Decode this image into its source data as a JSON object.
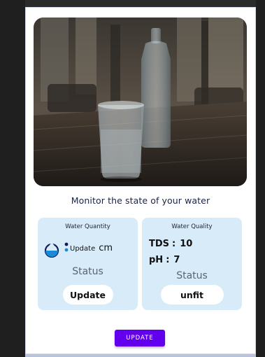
{
  "headline": "Monitor the state of your water",
  "quantity_card": {
    "title": "Water Quantity",
    "value_text": "Update",
    "unit": "cm",
    "status_label": "Status",
    "status_value": "Update"
  },
  "quality_card": {
    "title": "Water Quality",
    "tds_label": "TDS",
    "tds_value": "10",
    "ph_label": "pH",
    "ph_value": "7",
    "status_label": "Status",
    "status_value": "unfit"
  },
  "update_button": "UPDATE",
  "icons": [
    "water-drop-icon"
  ],
  "colors": {
    "accent": "#6200ee",
    "card_bg": "#d7ebf9"
  }
}
